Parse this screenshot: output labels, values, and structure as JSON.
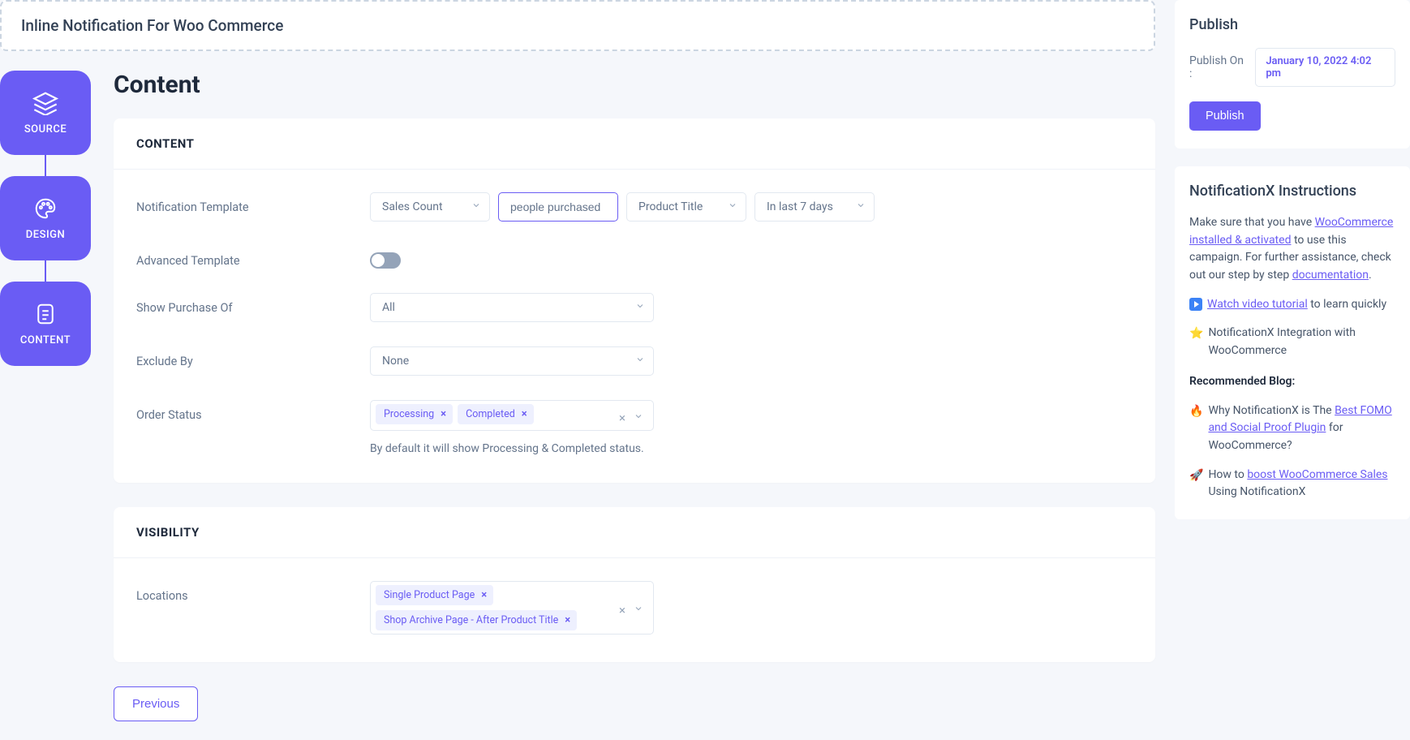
{
  "title": "Inline Notification For Woo Commerce",
  "steps": {
    "source": "SOURCE",
    "design": "DESIGN",
    "content": "CONTENT"
  },
  "heading": "Content",
  "sections": {
    "content": "CONTENT",
    "visibility": "VISIBILITY"
  },
  "form": {
    "notification_template": {
      "label": "Notification Template",
      "sel1": "Sales Count",
      "input": "people purchased",
      "sel2": "Product Title",
      "sel3": "In last 7 days"
    },
    "advanced_template": {
      "label": "Advanced Template",
      "enabled": false
    },
    "show_purchase_of": {
      "label": "Show Purchase Of",
      "value": "All"
    },
    "exclude_by": {
      "label": "Exclude By",
      "value": "None"
    },
    "order_status": {
      "label": "Order Status",
      "tags": [
        "Processing",
        "Completed"
      ],
      "helper": "By default it will show Processing & Completed status."
    },
    "locations": {
      "label": "Locations",
      "tags": [
        "Single Product Page",
        "Shop Archive Page - After Product Title"
      ]
    }
  },
  "buttons": {
    "previous": "Previous"
  },
  "sidebar": {
    "publish": {
      "title": "Publish",
      "on_label": "Publish On :",
      "datetime": "January 10, 2022 4:02 pm",
      "button": "Publish"
    },
    "instructions": {
      "title": "NotificationX Instructions",
      "intro1": "Make sure that you have ",
      "link1": "WooCommerce installed & activated",
      "intro2": " to use this campaign. For further assistance, check out our step by step ",
      "link2": "documentation",
      "watch": "Watch video tutorial",
      "watch_tail": " to learn quickly",
      "integration": "NotificationX Integration with WooCommerce",
      "recommended": "Recommended Blog:",
      "fire1": "Why NotificationX is The ",
      "fire_link": "Best FOMO and Social Proof Plugin",
      "fire2": " for WooCommerce?",
      "rocket1": "How to ",
      "rocket_link": "boost WooCommerce Sales",
      "rocket2": " Using NotificationX"
    }
  }
}
